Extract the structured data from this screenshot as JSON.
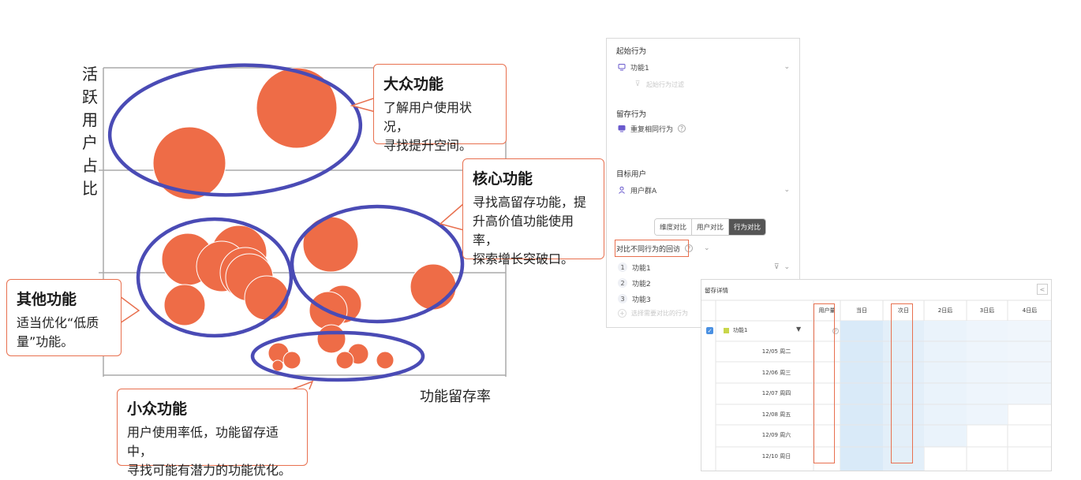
{
  "chart": {
    "y_label": "活\n跃\n用\n户\n占\n比",
    "x_label": "功能留存率",
    "colors": {
      "bubble": "#ee6c47",
      "ellipse": "#4a4bb5",
      "grid": "#aaaaaa",
      "callout_border": "#e8704f"
    }
  },
  "callouts": {
    "mass": {
      "title": "大众功能",
      "desc": "了解用户使用状况，\n寻找提升空间。"
    },
    "core": {
      "title": "核心功能",
      "desc": "寻找高留存功能，提\n升高价值功能使用率，\n探索增长突破口。"
    },
    "other": {
      "title": "其他功能",
      "desc": "适当优化“低质\n量”功能。"
    },
    "niche": {
      "title": "小众功能",
      "desc": "用户使用率低，功能留存适中，\n寻找可能有潜力的功能优化。"
    }
  },
  "config": {
    "start_label": "起始行为",
    "start_value": "功能1",
    "start_filter": "起始行为过滤",
    "retain_label": "留存行为",
    "retain_value": "重复相同行为",
    "target_label": "目标用户",
    "target_value": "用户群A",
    "tabs": [
      "维度对比",
      "用户对比",
      "行为对比"
    ],
    "compare_label": "对比不同行为的回访",
    "items": [
      {
        "num": "1",
        "label": "功能1"
      },
      {
        "num": "2",
        "label": "功能2"
      },
      {
        "num": "3",
        "label": "功能3"
      }
    ],
    "add_placeholder": "选择需要对比的行为"
  },
  "table": {
    "title": "留存详情",
    "close": "<",
    "headers": [
      "用户量",
      "当日",
      "次日",
      "2日后",
      "3日后",
      "4日后"
    ],
    "group_label": "功能1",
    "rows": [
      "12/05 周二",
      "12/06 周三",
      "12/07 周四",
      "12/08 周五",
      "12/09 周六",
      "12/10 周日"
    ]
  }
}
